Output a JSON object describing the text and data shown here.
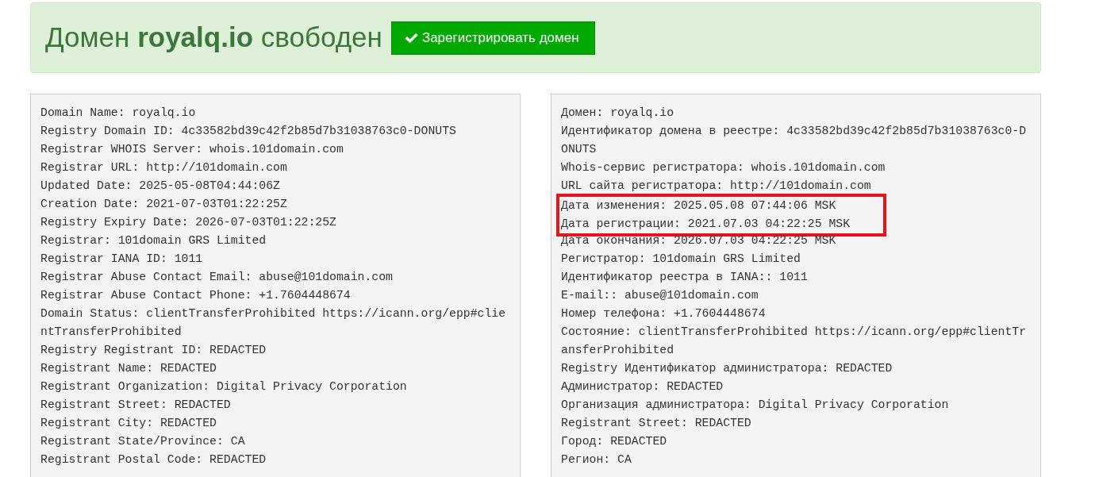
{
  "banner": {
    "heading": "Домен **royalq.io** свободен",
    "button": {
      "label": "Зарегистрировать домен"
    }
  },
  "panels": [
    {
      "lines": [
        {
          "text": "Domain Name: royalq.io",
          "highlighted": false
        },
        {
          "text": "Registry Domain ID: 4c33582bd39c42f2b85d7b31038763c0-DONUTS",
          "highlighted": false
        },
        {
          "text": "Registrar WHOIS Server: whois.101domain.com",
          "highlighted": false
        },
        {
          "text": "Registrar URL: http://101domain.com",
          "highlighted": false
        },
        {
          "text": "Updated Date: 2025-05-08T04:44:06Z",
          "highlighted": false
        },
        {
          "text": "Creation Date: 2021-07-03T01:22:25Z",
          "highlighted": false
        },
        {
          "text": "Registry Expiry Date: 2026-07-03T01:22:25Z",
          "highlighted": false
        },
        {
          "text": "Registrar: 101domain GRS Limited",
          "highlighted": false
        },
        {
          "text": "Registrar IANA ID: 1011",
          "highlighted": false
        },
        {
          "text": "Registrar Abuse Contact Email: abuse@101domain.com",
          "highlighted": false
        },
        {
          "text": "Registrar Abuse Contact Phone: +1.7604448674",
          "highlighted": false
        },
        {
          "text": "Domain Status: clientTransferProhibited https://icann.org/epp#clientTransferProhibited",
          "highlighted": false
        },
        {
          "text": "Registry Registrant ID: REDACTED",
          "highlighted": false
        },
        {
          "text": "Registrant Name: REDACTED",
          "highlighted": false
        },
        {
          "text": "Registrant Organization: Digital Privacy Corporation",
          "highlighted": false
        },
        {
          "text": "Registrant Street: REDACTED",
          "highlighted": false
        },
        {
          "text": "Registrant City: REDACTED",
          "highlighted": false
        },
        {
          "text": "Registrant State/Province: CA",
          "highlighted": false
        },
        {
          "text": "Registrant Postal Code: REDACTED",
          "highlighted": false
        }
      ]
    },
    {
      "lines": [
        {
          "text": "Домен: royalq.io",
          "highlighted": false
        },
        {
          "text": "Идентификатор домена в реестре: 4c33582bd39c42f2b85d7b31038763c0-DONUTS",
          "highlighted": false
        },
        {
          "text": "Whois-сервис регистратора: whois.101domain.com",
          "highlighted": false
        },
        {
          "text": "URL сайта регистратора: http://101domain.com",
          "highlighted": false
        },
        {
          "text": "Дата изменения: 2025.05.08 07:44:06 MSK",
          "highlighted": true
        },
        {
          "text": "Дата регистрации: 2021.07.03 04:22:25 MSK",
          "highlighted": true
        },
        {
          "text": "Дата окончания: 2026.07.03 04:22:25 MSK",
          "highlighted": false
        },
        {
          "text": "Регистратор: 101domain GRS Limited",
          "highlighted": false
        },
        {
          "text": "Идентификатор реестра в IANA:: 1011",
          "highlighted": false
        },
        {
          "text": "E-mail:: abuse@101domain.com",
          "highlighted": false
        },
        {
          "text": "Номер телефона: +1.7604448674",
          "highlighted": false
        },
        {
          "text": "Состояние: clientTransferProhibited https://icann.org/epp#clientTransferProhibited",
          "highlighted": false
        },
        {
          "text": "Registry Идентификатор администратора: REDACTED",
          "highlighted": false
        },
        {
          "text": "Администратор: REDACTED",
          "highlighted": false
        },
        {
          "text": "Организация администратора: Digital Privacy Corporation",
          "highlighted": false
        },
        {
          "text": "Registrant Street: REDACTED",
          "highlighted": false
        },
        {
          "text": "Город: REDACTED",
          "highlighted": false
        },
        {
          "text": "Регион: CA",
          "highlighted": false
        }
      ]
    }
  ]
}
